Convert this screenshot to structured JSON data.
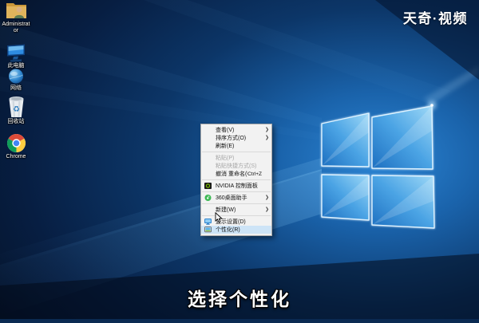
{
  "watermark": {
    "text": "天奇·视频"
  },
  "subtitle": {
    "text": "选择个性化"
  },
  "desktop_icons": [
    {
      "label": "Administrator",
      "icon": "user-folder-icon"
    },
    {
      "label": "此电脑",
      "icon": "this-pc-icon"
    },
    {
      "label": "网络",
      "icon": "network-icon"
    },
    {
      "label": "回收站",
      "icon": "recycle-bin-icon"
    },
    {
      "label": "Chrome",
      "icon": "chrome-icon"
    }
  ],
  "context_menu": {
    "items": [
      {
        "label": "查看(V)",
        "submenu": true
      },
      {
        "label": "排序方式(O)",
        "submenu": true
      },
      {
        "label": "刷新(E)"
      },
      {
        "label": "粘贴(P)",
        "disabled": true
      },
      {
        "label": "粘贴快捷方式(S)",
        "disabled": true
      },
      {
        "label": "撤消 重命名(U)",
        "shortcut": "Ctrl+Z"
      },
      {
        "label": "NVIDIA 控制面板",
        "icon": "nvidia-icon"
      },
      {
        "label": "360桌面助手",
        "icon": "desktop-assistant-icon",
        "submenu": true
      },
      {
        "label": "新建(W)",
        "submenu": true
      },
      {
        "label": "显示设置(D)",
        "icon": "display-settings-icon"
      },
      {
        "label": "个性化(R)",
        "icon": "personalize-icon",
        "highlighted": true
      }
    ]
  },
  "icons": {
    "submenu_arrow": "❯",
    "recycle_glyph": "♻"
  },
  "colors": {
    "wallpaper_glow": "#2c85d4",
    "wallpaper_dark": "#051329",
    "logo_stroke": "#dff3ff",
    "menu_background": "#f2f2f2",
    "menu_highlight": "#cde4f7",
    "nvidia_green": "#76b900",
    "assistant_green": "#3db954",
    "chrome_red": "#dd4b39",
    "chrome_green": "#0f9d58",
    "chrome_yellow": "#ffcd40",
    "chrome_blue": "#4285f4"
  }
}
